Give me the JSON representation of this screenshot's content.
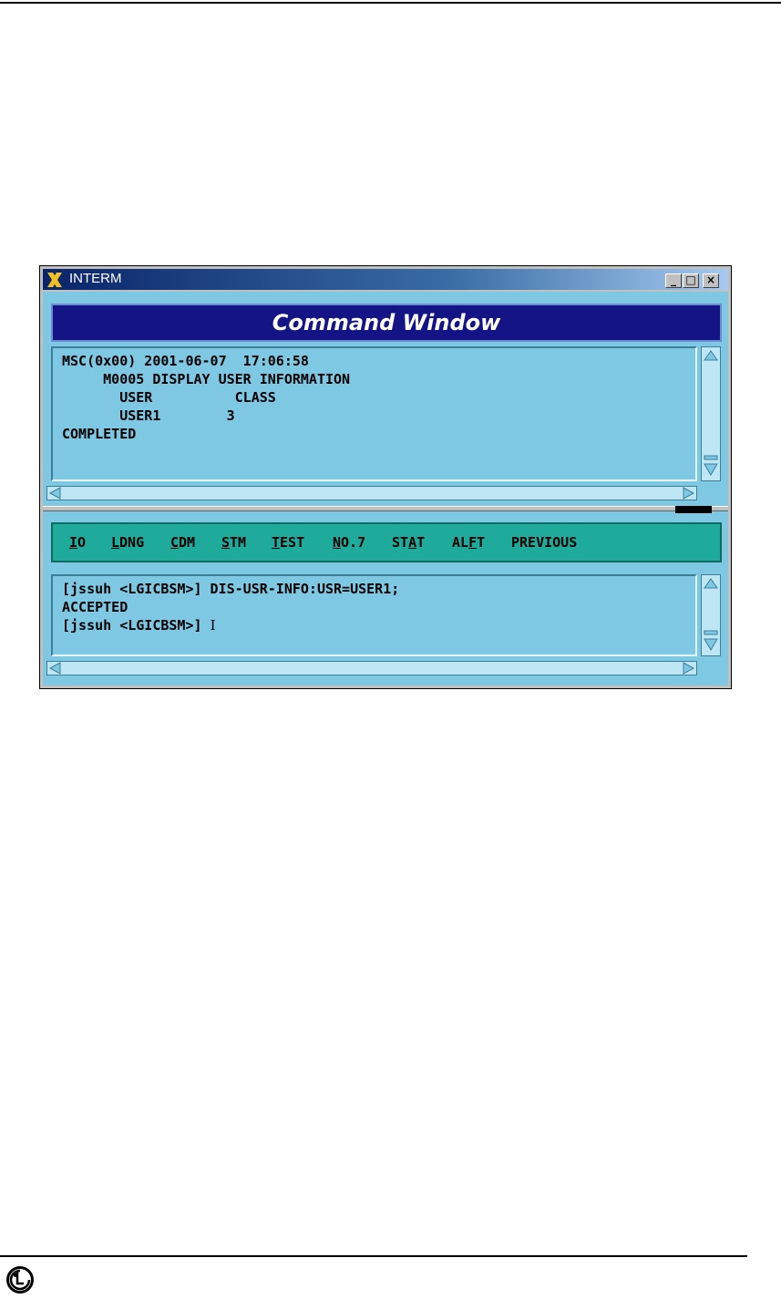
{
  "window": {
    "title": "INTERM",
    "minimize_label": "_",
    "maximize_label": "□",
    "close_label": "×"
  },
  "header": {
    "title": "Command Window"
  },
  "output": {
    "lines": [
      "MSC(0x00) 2001-06-07  17:06:58",
      "     M0005 DISPLAY USER INFORMATION",
      "       USER          CLASS",
      "       USER1        3",
      "COMPLETED"
    ]
  },
  "menu": {
    "items": [
      {
        "pre": "",
        "u": "I",
        "post": "O"
      },
      {
        "pre": "",
        "u": "L",
        "post": "DNG"
      },
      {
        "pre": "",
        "u": "C",
        "post": "DM"
      },
      {
        "pre": "",
        "u": "S",
        "post": "TM"
      },
      {
        "pre": "",
        "u": "T",
        "post": "EST"
      },
      {
        "pre": "",
        "u": "N",
        "post": "O.7"
      },
      {
        "pre": "ST",
        "u": "A",
        "post": "T"
      },
      {
        "pre": "AL",
        "u": "F",
        "post": "T"
      },
      {
        "pre": "",
        "u": "",
        "post": "PREVIOUS"
      }
    ]
  },
  "input": {
    "lines": [
      "[jssuh <LGICBSM>] DIS-USR-INFO:USR=USER1;",
      "ACCEPTED",
      "[jssuh <LGICBSM>]"
    ],
    "caret": "I"
  },
  "footer": {
    "logo_text": "LG"
  }
}
